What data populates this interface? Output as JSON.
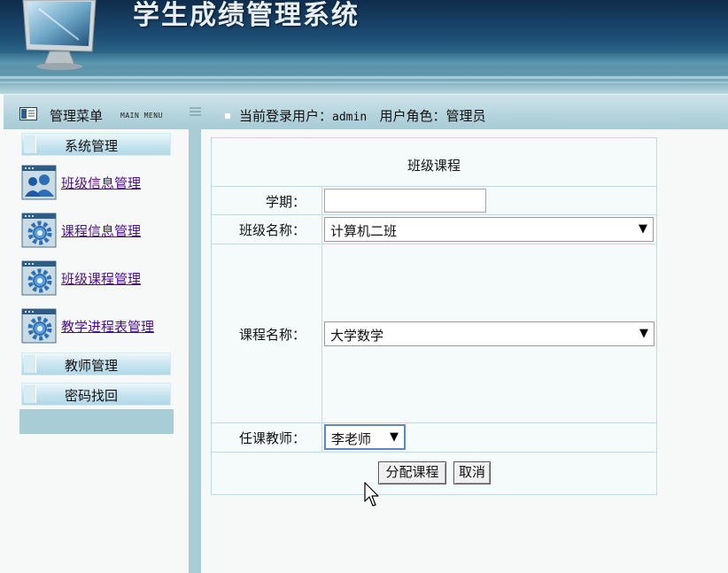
{
  "header": {
    "system_title": "学生成绩管理系统",
    "icon": "monitor-icon"
  },
  "menu_bar": {
    "title": "管理菜单",
    "subtitle": "MAIN MENU",
    "user_prefix": "当前登录用户：",
    "username": "admin",
    "role_prefix": "用户角色：",
    "role": "管理员"
  },
  "sidebar": {
    "sections": [
      {
        "label": "系统管理"
      },
      {
        "label": "教师管理"
      },
      {
        "label": "密码找回"
      }
    ],
    "items": [
      {
        "label": "班级信息管理",
        "icon": "users-icon"
      },
      {
        "label": "课程信息管理",
        "icon": "gear-icon"
      },
      {
        "label": "班级课程管理",
        "icon": "gear-icon"
      },
      {
        "label": "教学进程表管理",
        "icon": "gear-icon"
      }
    ]
  },
  "form": {
    "title": "班级课程",
    "semester_label": "学期：",
    "semester_value": "",
    "class_label": "班级名称：",
    "class_value": "计算机二班",
    "course_label": "课程名称：",
    "course_value": "大学数学",
    "teacher_label": "任课教师：",
    "teacher_value": "李老师",
    "submit_label": "分配课程",
    "cancel_label": "取消"
  },
  "colors": {
    "accent": "#a9cdd6",
    "link": "#4a0f86",
    "banner_dark": "#0f2c4b"
  }
}
